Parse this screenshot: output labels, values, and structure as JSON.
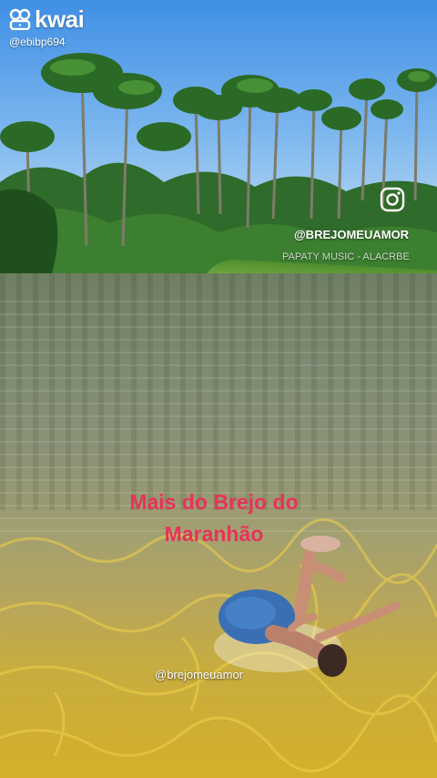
{
  "app": {
    "brand": "kwai",
    "user_handle": "@ebibp694"
  },
  "video": {
    "description": "",
    "watermark_handle": "@BREJOMEUAMOR",
    "music_credit": "PAPATY MUSIC - ALACRBE",
    "caption_lines": [
      "Mais do Brejo do",
      "Maranhão"
    ],
    "caption_color": "#e8325a",
    "bottom_handle": "@brejomeuamor"
  },
  "icons": {
    "brand_logo": "kwai-logo-icon",
    "instagram": "instagram-icon"
  }
}
